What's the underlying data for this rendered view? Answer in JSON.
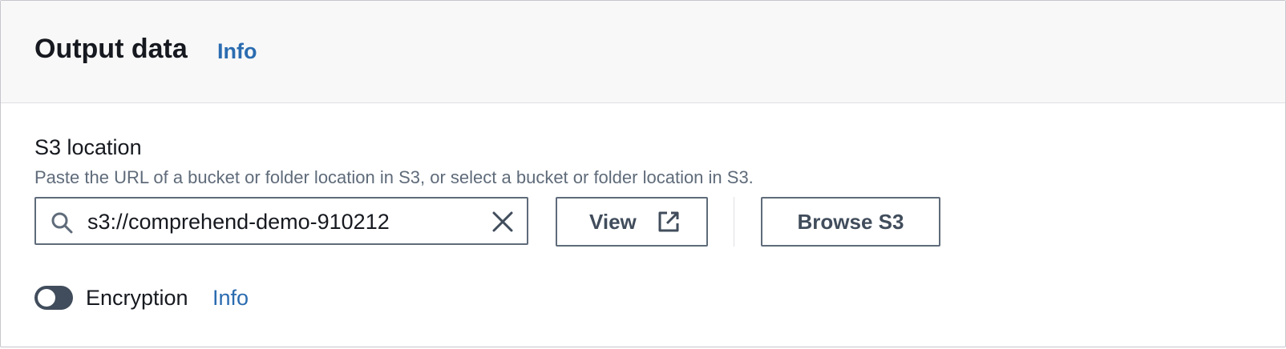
{
  "header": {
    "title": "Output data",
    "info_link": "Info"
  },
  "s3_location": {
    "label": "S3 location",
    "description": "Paste the URL of a bucket or folder location in S3, or select a bucket or folder location in S3.",
    "value": "s3://comprehend-demo-910212",
    "view_button": "View",
    "browse_button": "Browse S3"
  },
  "encryption": {
    "label": "Encryption",
    "info_link": "Info",
    "enabled": false
  },
  "icons": {
    "search": "search-icon",
    "clear": "close-icon",
    "external": "external-link-icon"
  },
  "colors": {
    "link": "#2b6cb0",
    "text": "#16191f",
    "secondary_text": "#5f6b7a",
    "toggle_off": "#414d5c",
    "header_bg": "#f8f8f8"
  }
}
